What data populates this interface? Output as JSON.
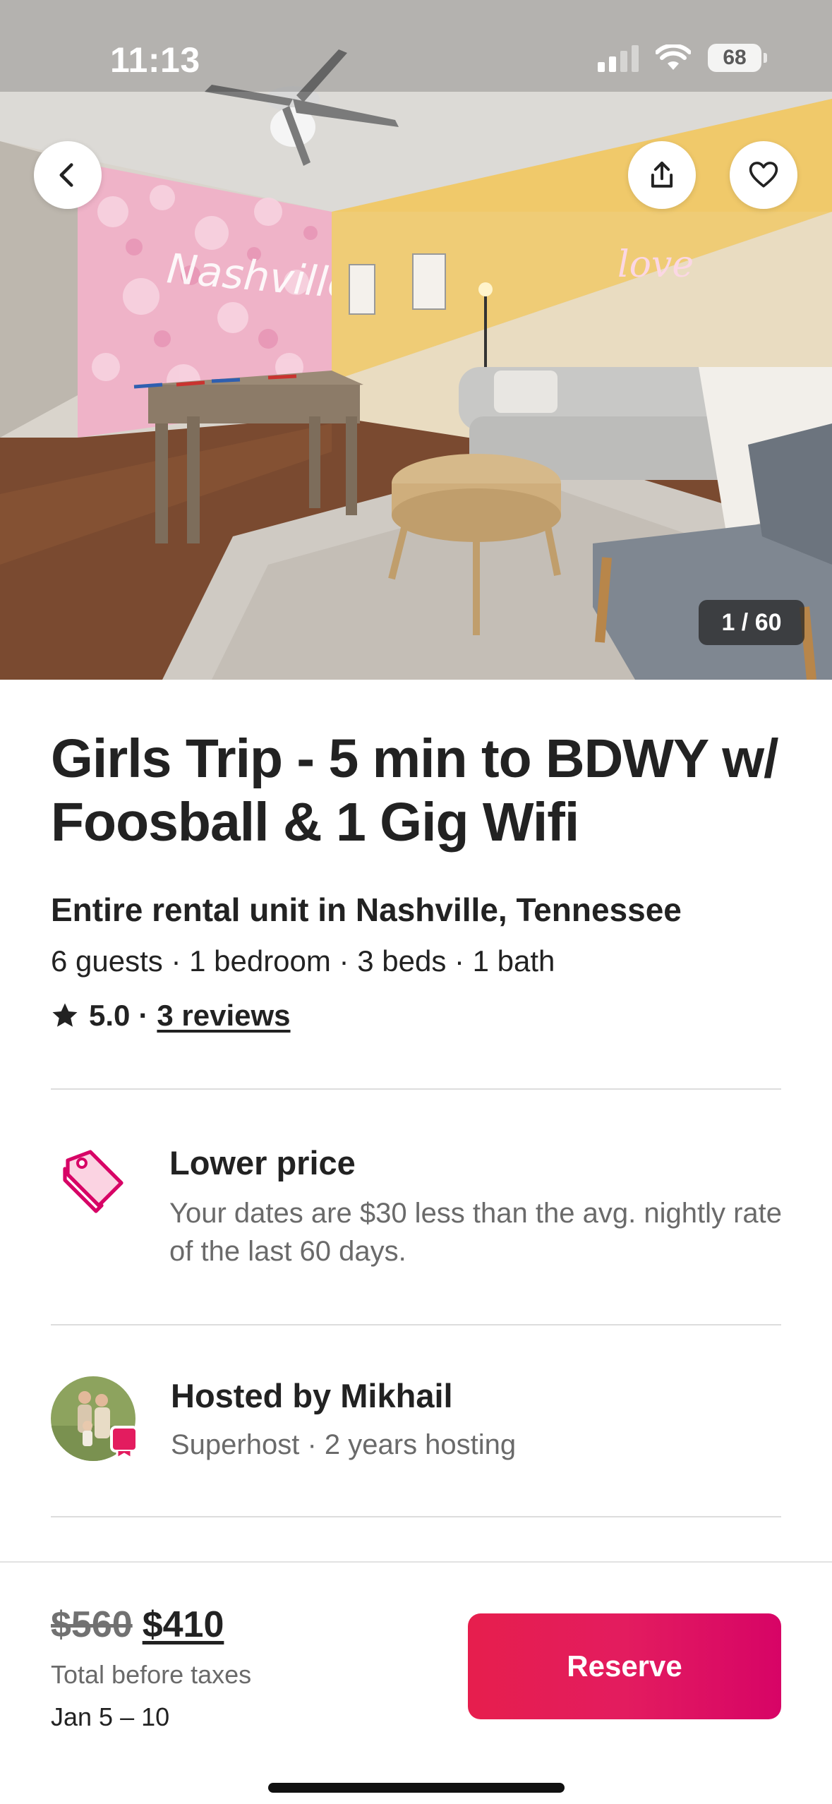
{
  "status_bar": {
    "time": "11:13",
    "battery": "68"
  },
  "gallery": {
    "counter": "1 / 60"
  },
  "listing": {
    "title": "Girls Trip - 5 min to BDWY w/ Foosball & 1 Gig Wifi",
    "subtitle": "Entire rental unit in Nashville, Tennessee",
    "details": "6 guests · 1 bedroom · 3 beds · 1 bath",
    "rating": "5.0",
    "reviews_link": "3 reviews"
  },
  "lower_price": {
    "title": "Lower price",
    "description": "Your dates are $30 less than the avg. nightly rate of the last 60 days."
  },
  "host": {
    "title": "Hosted by Mikhail",
    "subtitle": "Superhost · 2 years hosting"
  },
  "footer": {
    "original_price": "$560",
    "price": "$410",
    "price_note": "Total before taxes",
    "dates": "Jan 5 – 10",
    "reserve_label": "Reserve"
  },
  "colors": {
    "brand": "#E31C5F",
    "text_primary": "#222222",
    "text_secondary": "#6A6A6A",
    "divider": "#DDDDDD"
  },
  "icons": [
    "back-icon",
    "share-icon",
    "heart-icon",
    "star-icon",
    "price-tag-icon",
    "superhost-badge-icon"
  ]
}
